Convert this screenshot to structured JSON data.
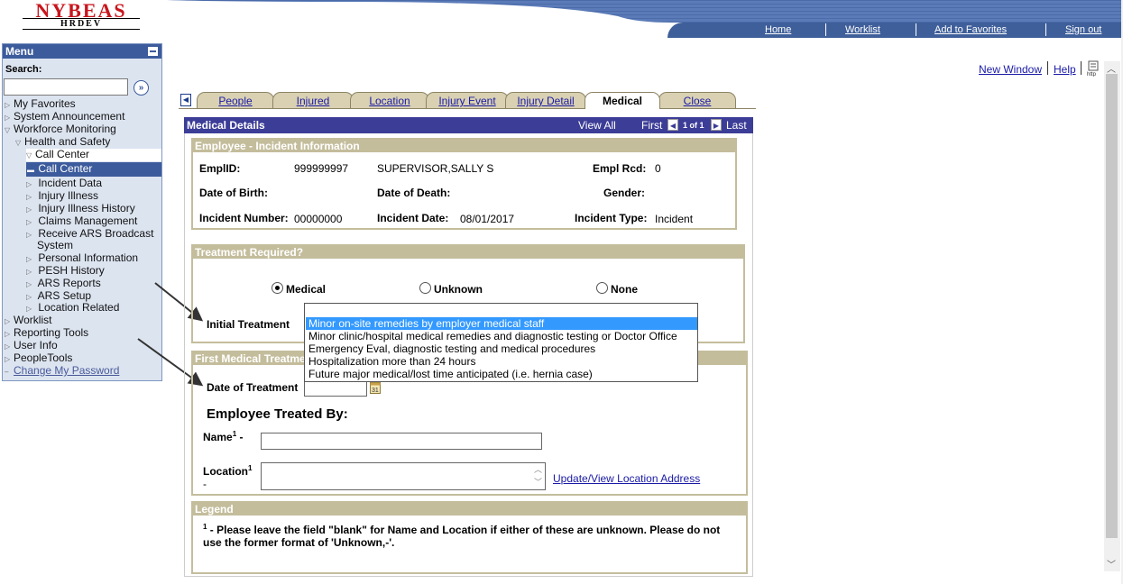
{
  "brand": {
    "name": "NYBEAS",
    "env": "HRDEV"
  },
  "topnav": {
    "home": "Home",
    "worklist": "Worklist",
    "favorites": "Add to Favorites",
    "signout": "Sign out"
  },
  "util": {
    "new_window": "New Window",
    "help": "Help"
  },
  "menu": {
    "title": "Menu",
    "search_label": "Search:",
    "search_value": "",
    "items": [
      {
        "label": "My Favorites"
      },
      {
        "label": "System Announcement"
      },
      {
        "label": "Workforce Monitoring"
      },
      {
        "label": "Health and Safety"
      },
      {
        "label": "Call Center"
      },
      {
        "label": "Call Center"
      },
      {
        "label": "Incident Data"
      },
      {
        "label": "Injury Illness"
      },
      {
        "label": "Injury Illness History"
      },
      {
        "label": "Claims Management"
      },
      {
        "label": "Receive ARS Broadcast"
      },
      {
        "label": "System"
      },
      {
        "label": "Personal Information"
      },
      {
        "label": "PESH History"
      },
      {
        "label": "ARS Reports"
      },
      {
        "label": "ARS Setup"
      },
      {
        "label": "Location Related"
      },
      {
        "label": "Worklist"
      },
      {
        "label": "Reporting Tools"
      },
      {
        "label": "User Info"
      },
      {
        "label": "PeopleTools"
      },
      {
        "label": "Change My Password"
      }
    ]
  },
  "tabs": [
    {
      "label": "People"
    },
    {
      "label": "Injured"
    },
    {
      "label": "Location"
    },
    {
      "label": "Injury Event"
    },
    {
      "label": "Injury Detail"
    },
    {
      "label": "Medical"
    },
    {
      "label": "Close"
    }
  ],
  "medical": {
    "header": "Medical Details",
    "view_all": "View All",
    "first": "First",
    "count": "1 of 1",
    "last": "Last"
  },
  "employee": {
    "section": "Employee - Incident Information",
    "emplid_label": "EmplID:",
    "emplid": "999999997",
    "name": "SUPERVISOR,SALLY S",
    "rcd_label": "Empl Rcd:",
    "rcd": "0",
    "dob_label": "Date of Birth:",
    "dod_label": "Date of Death:",
    "gender_label": "Gender:",
    "incnum_label": "Incident Number:",
    "incnum": "00000000",
    "incdate_label": "Incident Date:",
    "incdate": "08/01/2017",
    "inctype_label": "Incident Type:",
    "inctype": "Incident"
  },
  "treatment": {
    "section": "Treatment Required?",
    "opt_medical": "Medical",
    "opt_unknown": "Unknown",
    "opt_none": "None",
    "selected": "Medical",
    "initial_label": "Initial Treatment",
    "dropdown": [
      "Minor on-site remedies by employer medical staff",
      "Minor clinic/hospital medical remedies and diagnostic testing or Doctor Office",
      "Emergency Eval, diagnostic testing and medical procedures",
      "Hospitalization more than 24 hours",
      "Future major medical/lost time anticipated (i.e. hernia case)"
    ],
    "dropdown_selected": "Minor on-site remedies by employer medical staff"
  },
  "first_med": {
    "section": "First Medical Treatment",
    "date_label": "Date of Treatment",
    "date_value": "",
    "treated_by": "Employee Treated By:",
    "name_label": "Name",
    "name_sup": "1",
    "name_suffix": " -",
    "name_value": "",
    "loc_label": "Location",
    "loc_sup": "1",
    "loc_suffix": "-",
    "loc_value": "",
    "loc_link": "Update/View Location Address"
  },
  "legend": {
    "section": "Legend",
    "sup": "1",
    "text": " - Please leave the field \"blank\" for Name and Location if either of these are unknown. Please do not use the former format of 'Unknown,-'."
  },
  "colors": {
    "menu_header": "#3c5b9c",
    "section_header": "#c4bd9c",
    "grid_header": "#3c3d97",
    "highlight": "#3399ff",
    "logo_red": "#c8161d"
  }
}
